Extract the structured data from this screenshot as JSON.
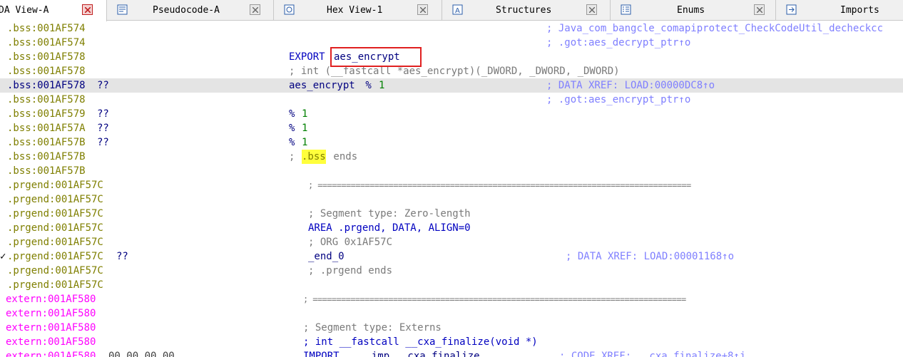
{
  "tabs": [
    {
      "label": "DA View-A",
      "icon": "ida-view-icon",
      "active": true
    },
    {
      "label": "Pseudocode-A",
      "icon": "pseudocode-icon",
      "active": false
    },
    {
      "label": "Hex View-1",
      "icon": "hex-view-icon",
      "active": false
    },
    {
      "label": "Structures",
      "icon": "structures-icon",
      "active": false
    },
    {
      "label": "Enums",
      "icon": "enums-icon",
      "active": false
    },
    {
      "label": "Imports",
      "icon": "imports-icon",
      "active": false
    }
  ],
  "lines": [
    {
      "addr": ".bss:001AF574",
      "comment": "; Java_com_bangcle_comapiprotect_CheckCodeUtil_decheckcc"
    },
    {
      "addr": ".bss:001AF574",
      "comment": "; .got:aes_decrypt_ptr↑o"
    },
    {
      "addr": ".bss:001AF578",
      "kw": "EXPORT",
      "name": "aes_encrypt"
    },
    {
      "addr": ".bss:001AF578",
      "decl": "; int (__fastcall *aes_encrypt)(_DWORD, _DWORD, _DWORD)"
    },
    {
      "addr": ".bss:001AF578",
      "bytes": "??",
      "name": "aes_encrypt",
      "op": " % ",
      "num": "1",
      "comment": "; DATA XREF: LOAD:00000DC8↑o"
    },
    {
      "addr": ".bss:001AF578",
      "comment": "; .got:aes_encrypt_ptr↑o"
    },
    {
      "addr": ".bss:001AF579",
      "bytes": "??",
      "op": "% ",
      "num": "1"
    },
    {
      "addr": ".bss:001AF57A",
      "bytes": "??",
      "op": "% ",
      "num": "1"
    },
    {
      "addr": ".bss:001AF57B",
      "bytes": "??",
      "op": "% ",
      "num": "1"
    },
    {
      "addr": ".bss:001AF57B",
      "semi": "; ",
      "seg": ".bss",
      "rest": " ends"
    },
    {
      "addr": ".bss:001AF57B"
    },
    {
      "addr": ".prgend:001AF57C",
      "rule": "; ==============================================================================="
    },
    {
      "addr": ".prgend:001AF57C"
    },
    {
      "addr": ".prgend:001AF57C",
      "cmt2": "; Segment type: Zero-length"
    },
    {
      "addr": ".prgend:001AF57C",
      "area": "AREA .prgend, DATA, ALIGN=0"
    },
    {
      "addr": ".prgend:001AF57C",
      "cmt2": "; ORG 0x1AF57C"
    },
    {
      "addr": ".prgend:001AF57C",
      "bytes": "??",
      "name": "_end_0",
      "comment": "; DATA XREF: LOAD:00001168↑o"
    },
    {
      "addr": ".prgend:001AF57C",
      "cmt2": "; .prgend ends"
    },
    {
      "addr": ".prgend:001AF57C"
    },
    {
      "addr": "extern:001AF580",
      "rule": "; ==============================================================================="
    },
    {
      "addr": "extern:001AF580"
    },
    {
      "addr": "extern:001AF580",
      "cmt2": "; Segment type: Externs"
    },
    {
      "addr": "extern:001AF580",
      "decl2": "; int __fastcall __cxa_finalize(void *)"
    },
    {
      "addr": "extern:001AF580",
      "bytes": "00 00 00 00",
      "kw": "IMPORT",
      "name": "__imp___cxa_finalize",
      "comment": "; CODE XREF: __cxa_finalize+8↑j"
    }
  ]
}
